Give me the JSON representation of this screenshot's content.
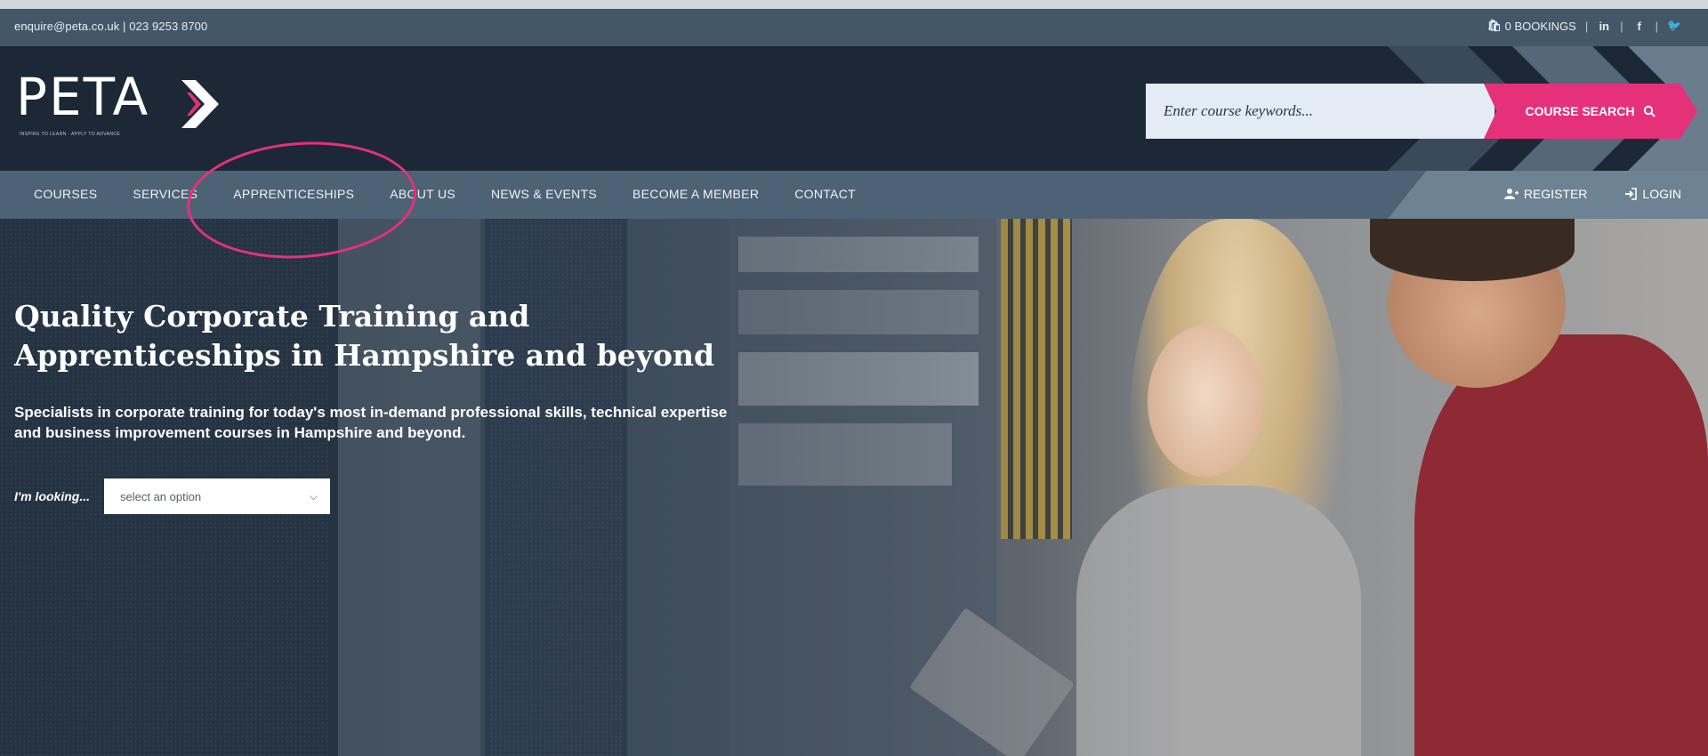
{
  "topbar": {
    "contact": "enquire@peta.co.uk | 023 9253 8700",
    "bookings": "0 BOOKINGS",
    "linkedin_icon": "linkedin-icon",
    "facebook_icon": "facebook-icon",
    "twitter_icon": "twitter-icon"
  },
  "logo": {
    "text": "PETA",
    "tagline": "INSPIRE TO LEARN · APPLY TO ADVANCE"
  },
  "search": {
    "placeholder": "Enter course keywords...",
    "button_label": "COURSE SEARCH"
  },
  "nav": {
    "items": [
      "COURSES",
      "SERVICES",
      "APPRENTICESHIPS",
      "ABOUT US",
      "NEWS & EVENTS",
      "BECOME A MEMBER",
      "CONTACT"
    ],
    "register": "REGISTER",
    "login": "LOGIN"
  },
  "hero": {
    "title_line1": "Quality Corporate Training and",
    "title_line2": "Apprenticeships in Hampshire and beyond",
    "subtitle_line1": "Specialists in corporate training for today's most in-demand professional skills, technical expertise",
    "subtitle_line2": "and business improvement courses in Hampshire and beyond.",
    "looking_label": "I'm looking...",
    "select_value": "select an option"
  },
  "colors": {
    "accent": "#e5317a",
    "header_bg": "#1c2836",
    "nav_bg": "#4e6275",
    "topbar_bg": "#445769"
  }
}
